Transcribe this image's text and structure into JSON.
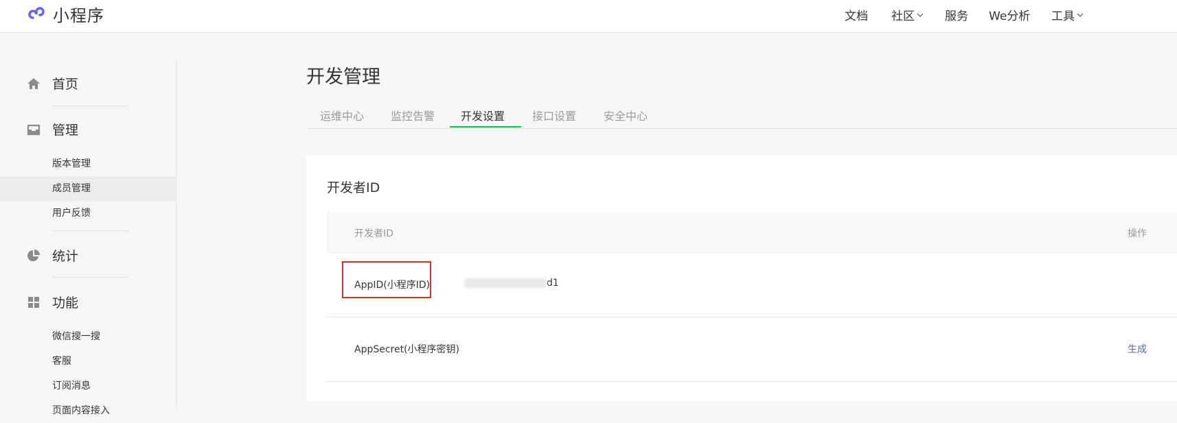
{
  "app": {
    "logo_text": "小程序"
  },
  "topnav": {
    "docs": "文档",
    "community": "社区",
    "services": "服务",
    "we_analysis": "We分析",
    "tools": "工具"
  },
  "sidebar": {
    "home": "首页",
    "manage": "管理",
    "manage_items": [
      "版本管理",
      "成员管理",
      "用户反馈"
    ],
    "stats": "统计",
    "features": "功能",
    "feature_items": [
      "微信搜一搜",
      "客服",
      "订阅消息",
      "页面内容接入"
    ]
  },
  "main": {
    "title": "开发管理",
    "tabs": [
      "运维中心",
      "监控告警",
      "开发设置",
      "接口设置",
      "安全中心"
    ],
    "active_tab": "开发设置"
  },
  "card": {
    "title": "开发者ID",
    "table": {
      "col_id": "开发者ID",
      "col_action": "操作",
      "rows": [
        {
          "label": "AppID(小程序ID)",
          "value_suffix": "d1",
          "action": ""
        },
        {
          "label": "AppSecret(小程序密钥)",
          "value_suffix": "",
          "action": "生成"
        }
      ]
    }
  },
  "colors": {
    "accent_green": "#07c160",
    "link_blue": "#576b95",
    "highlight_red": "#d8302a"
  }
}
